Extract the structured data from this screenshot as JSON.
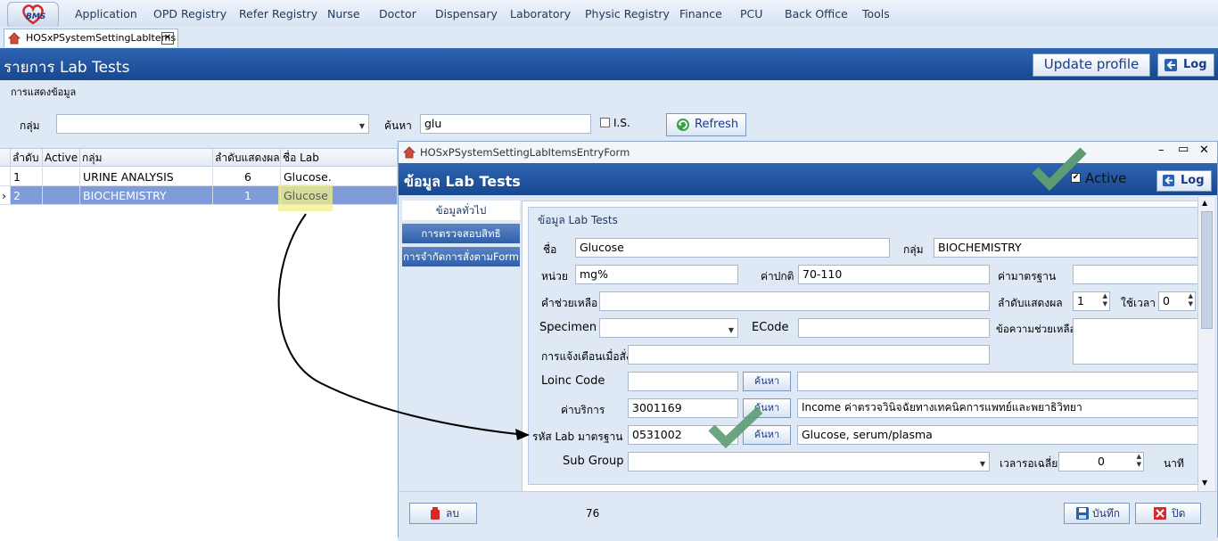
{
  "menu": {
    "logo_text": "BMS",
    "items": [
      "Application",
      "OPD Registry",
      "Refer Registry",
      "Nurse",
      "Doctor",
      "Dispensary",
      "Laboratory",
      "Physic Registry",
      "Finance",
      "PCU",
      "Back Office",
      "Tools"
    ]
  },
  "doc_tab": {
    "label": "HOSxPSystemSettingLabItems",
    "close": "✕"
  },
  "title_bar": {
    "title": "รายการ Lab Tests",
    "update_profile": "Update profile",
    "log": "Log"
  },
  "section_label": "การแสดงข้อมูล",
  "filter": {
    "group_label": "กลุ่ม",
    "group_value": "",
    "search_label": "ค้นหา",
    "search_value": "glu",
    "is_label": "I.S.",
    "is_checked": false,
    "refresh": "Refresh"
  },
  "grid": {
    "headers": [
      "ลำดับ",
      "Active",
      "กลุ่ม",
      "ลำดับแสดงผล",
      "ชื่อ Lab"
    ],
    "rows": [
      {
        "no": "1",
        "active": "",
        "group": "URINE ANALYSIS",
        "order": "6",
        "name": "Glucose."
      },
      {
        "no": "2",
        "active": "",
        "group": "BIOCHEMISTRY",
        "order": "1",
        "name": "Glucose"
      }
    ],
    "selected_row": 2
  },
  "dialog": {
    "window_title": "HOSxPSystemSettingLabItemsEntryForm",
    "header_title": "ข้อมูล Lab Tests",
    "active_label": "Active",
    "active_checked": true,
    "log": "Log",
    "side_tabs": [
      "ข้อมูลทั่วไป",
      "การตรวจสอบสิทธิ",
      "การจำกัดการสั่งตามForm"
    ],
    "group_title": "ข้อมูล Lab Tests",
    "fields": {
      "name_label": "ชื่อ",
      "name_value": "Glucose",
      "group_label": "กลุ่ม",
      "group_value": "BIOCHEMISTRY",
      "unit_label": "หน่วย",
      "unit_value": "mg%",
      "normal_label": "ค่าปกติ",
      "normal_value": "70-110",
      "standard_label": "ค่ามาตรฐาน",
      "standard_value": "",
      "help_label": "คำช่วยเหลือ",
      "help_value": "",
      "display_order_label": "ลำดับแสดงผล",
      "display_order_value": "1",
      "time_label": "ใช้เวลา",
      "time_value": "0",
      "specimen_label": "Specimen",
      "specimen_value": "",
      "ecode_label": "ECode",
      "ecode_value": "",
      "help_msg_label": "ข้อความช่วยเหลือ",
      "help_msg_value": "",
      "warn_label": "การแจ้งเตือนเมื่อสั่ง",
      "warn_value": "",
      "loinc_label": "Loinc Code",
      "loinc_value": "",
      "loinc_desc": "",
      "service_label": "ค่าบริการ",
      "service_value": "3001169",
      "service_desc": "Income ค่าตรวจวินิจฉัยทางเทคนิคการแพทย์และพยาธิวิทยา",
      "std_code_label": "รหัส Lab มาตรฐาน",
      "std_code_value": "0531002",
      "std_code_desc": "Glucose, serum/plasma",
      "subgroup_label": "Sub Group",
      "subgroup_value": "",
      "avg_time_label": "เวลารอเฉลี่ย",
      "avg_time_value": "0",
      "minute_label": "นาที",
      "search_button": "ค้นหา"
    },
    "footer": {
      "delete": "ลบ",
      "count": "76",
      "save": "บันทึก",
      "close": "ปิด"
    }
  },
  "colors": {
    "header_blue": "#1f4f9c",
    "selected_row": "#7f9bd8",
    "highlight": "#f2f28a",
    "check_green": "#5d9b73",
    "arrow": "#000000"
  }
}
